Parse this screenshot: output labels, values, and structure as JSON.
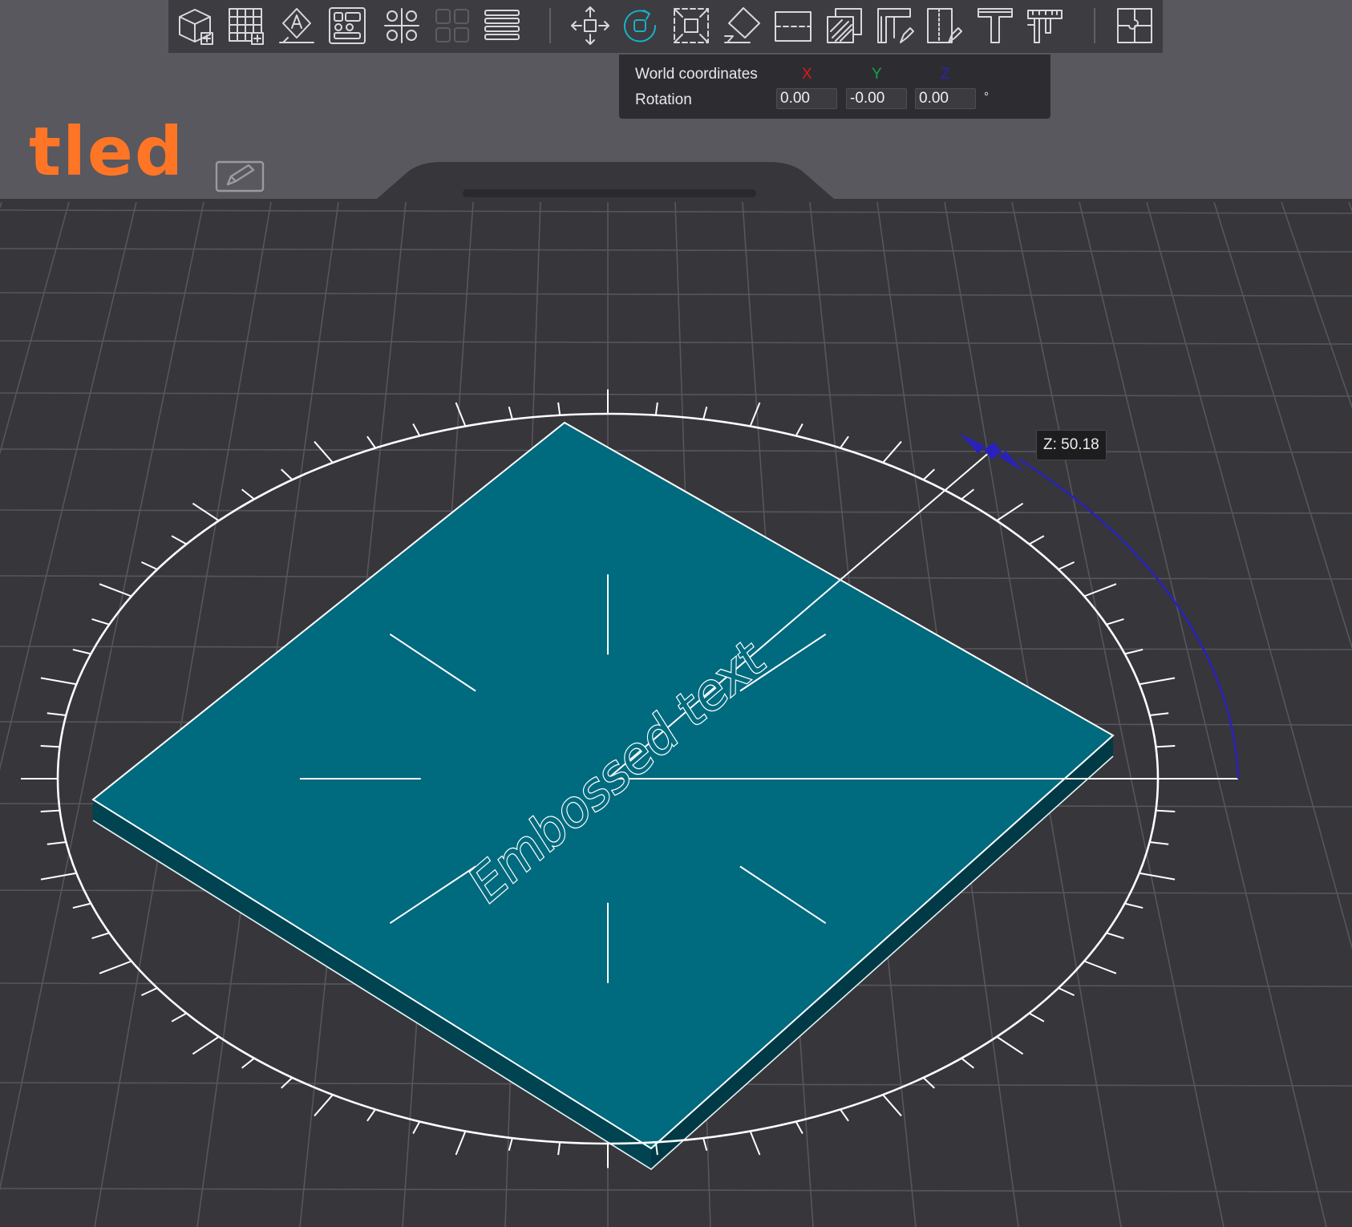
{
  "project": {
    "title_visible": "tled"
  },
  "toolbar": {
    "tools": [
      {
        "name": "add-object-button",
        "icon": "cube-add-icon",
        "state": "normal"
      },
      {
        "name": "add-grid-button",
        "icon": "grid-add-icon",
        "state": "normal"
      },
      {
        "name": "place-on-face-button",
        "icon": "place-on-face-icon",
        "state": "normal"
      },
      {
        "name": "arrange-button",
        "icon": "arrange-icon",
        "state": "normal"
      },
      {
        "name": "split-objects-button",
        "icon": "split-objects-icon",
        "state": "normal"
      },
      {
        "name": "split-parts-button",
        "icon": "split-parts-icon",
        "state": "disabled"
      },
      {
        "name": "layers-button",
        "icon": "layers-icon",
        "state": "normal"
      },
      {
        "name": "move-tool-button",
        "icon": "move-icon",
        "state": "normal"
      },
      {
        "name": "rotate-tool-button",
        "icon": "rotate-icon",
        "state": "active"
      },
      {
        "name": "scale-tool-button",
        "icon": "scale-icon",
        "state": "normal"
      },
      {
        "name": "lay-on-face-button",
        "icon": "lay-on-face-icon",
        "state": "normal"
      },
      {
        "name": "cut-tool-button",
        "icon": "cut-icon",
        "state": "normal"
      },
      {
        "name": "paint-support-button",
        "icon": "support-paint-icon",
        "state": "normal"
      },
      {
        "name": "paint-seam-button",
        "icon": "seam-paint-icon",
        "state": "normal"
      },
      {
        "name": "paint-color-button",
        "icon": "color-paint-icon",
        "state": "normal"
      },
      {
        "name": "text-tool-button",
        "icon": "text-icon",
        "state": "normal"
      },
      {
        "name": "measure-tool-button",
        "icon": "measure-icon",
        "state": "normal"
      },
      {
        "name": "assembly-button",
        "icon": "assembly-icon",
        "state": "normal"
      }
    ]
  },
  "rotation_panel": {
    "coord_label": "World coordinates",
    "axes": {
      "x": "X",
      "y": "Y",
      "z": "Z"
    },
    "rotation_label": "Rotation",
    "values": {
      "x": "0.00",
      "y": "-0.00",
      "z": "0.00"
    },
    "unit": "°"
  },
  "viewport": {
    "embossed_text": "Embossed text",
    "z_tooltip": "Z: 50.18"
  },
  "colors": {
    "background": "#36363b",
    "grid": "#56565d",
    "plate_top": "#006a7e",
    "plate_side": "#004452",
    "accent_orange": "#ff7526",
    "active_tool": "#1ab0c2",
    "axis_x": "#e01818",
    "axis_y": "#15a34a",
    "axis_z": "#2a22b8",
    "gizmo": "#ffffff"
  }
}
